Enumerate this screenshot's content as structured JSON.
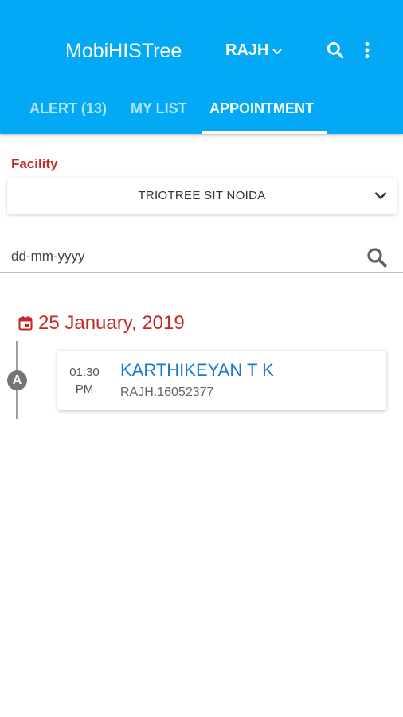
{
  "appbar": {
    "title": "MobiHISTree",
    "facility_code": "RAJH",
    "icons": {
      "dropdown": "chevron-down-icon",
      "search": "search-icon",
      "more": "more-vert-icon"
    }
  },
  "tabs": [
    {
      "label": "ALERT (13)",
      "active": false
    },
    {
      "label": "MY LIST",
      "active": false
    },
    {
      "label": "APPOINTMENT",
      "active": true
    }
  ],
  "filter": {
    "facility_label": "Facility",
    "facility_value": "TRIOTREE SIT NOIDA",
    "date_placeholder": "dd-mm-yyyy"
  },
  "appointments": {
    "date": "25 January, 2019",
    "items": [
      {
        "badge": "A",
        "time": "01:30",
        "meridiem": "PM",
        "patient_name": "KARTHIKEYAN T K",
        "patient_id": "RAJH.16052377"
      }
    ]
  },
  "colors": {
    "primary": "#03A9F4",
    "accent_red": "#C62828",
    "link_blue": "#1976D2"
  }
}
